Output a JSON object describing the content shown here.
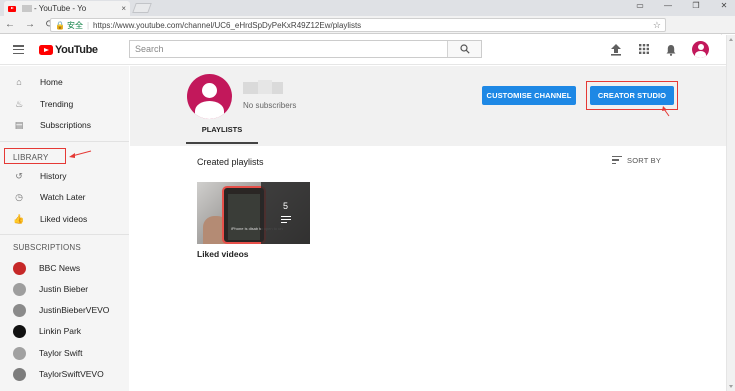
{
  "browser": {
    "tab_title": "- YouTube - Yo",
    "tab_close": "×",
    "secure_label": "安全",
    "url": "https://www.youtube.com/channel/UC6_eHrdSpDyPeKxR49Z12Ew/playlists",
    "window_controls": [
      "▭",
      "—",
      "❐",
      "✕"
    ],
    "nav": [
      "←",
      "→",
      "⟳"
    ]
  },
  "header": {
    "logo_text": "YouTube",
    "search_placeholder": "Search",
    "icons": [
      "menu-icon",
      "upload-icon",
      "apps-icon",
      "notifications-icon",
      "avatar"
    ]
  },
  "sidebar": {
    "main_items": [
      {
        "label": "Home",
        "icon": "⌂"
      },
      {
        "label": "Trending",
        "icon": "♨"
      },
      {
        "label": "Subscriptions",
        "icon": "▤"
      }
    ],
    "library_heading": "LIBRARY",
    "library_items": [
      {
        "label": "History",
        "icon": "↺"
      },
      {
        "label": "Watch Later",
        "icon": "◷"
      },
      {
        "label": "Liked videos",
        "icon": "👍"
      }
    ],
    "subscriptions_heading": "SUBSCRIPTIONS",
    "subscriptions": [
      {
        "label": "BBC News",
        "color": "#c62828"
      },
      {
        "label": "Justin Bieber",
        "color": "#9e9e9e"
      },
      {
        "label": "JustinBieberVEVO",
        "color": "#8a8a8a"
      },
      {
        "label": "Linkin Park",
        "color": "#111111"
      },
      {
        "label": "Taylor Swift",
        "color": "#a1a1a1"
      },
      {
        "label": "TaylorSwiftVEVO",
        "color": "#7d7d7d"
      }
    ]
  },
  "channel": {
    "subscribers": "No subscribers",
    "customise_button": "CUSTOMISE CHANNEL",
    "studio_button": "CREATOR STUDIO",
    "tab": "PLAYLISTS"
  },
  "playlists": {
    "section_title": "Created playlists",
    "sort_label": "SORT BY",
    "items": [
      {
        "title": "Liked videos",
        "count": "5",
        "phone_text": "iPhone is disab\nto open to un"
      }
    ]
  },
  "colors": {
    "accent": "#1e88e5",
    "annotation": "#e53935",
    "brand": "#ff0000",
    "avatar": "#c2185b"
  }
}
